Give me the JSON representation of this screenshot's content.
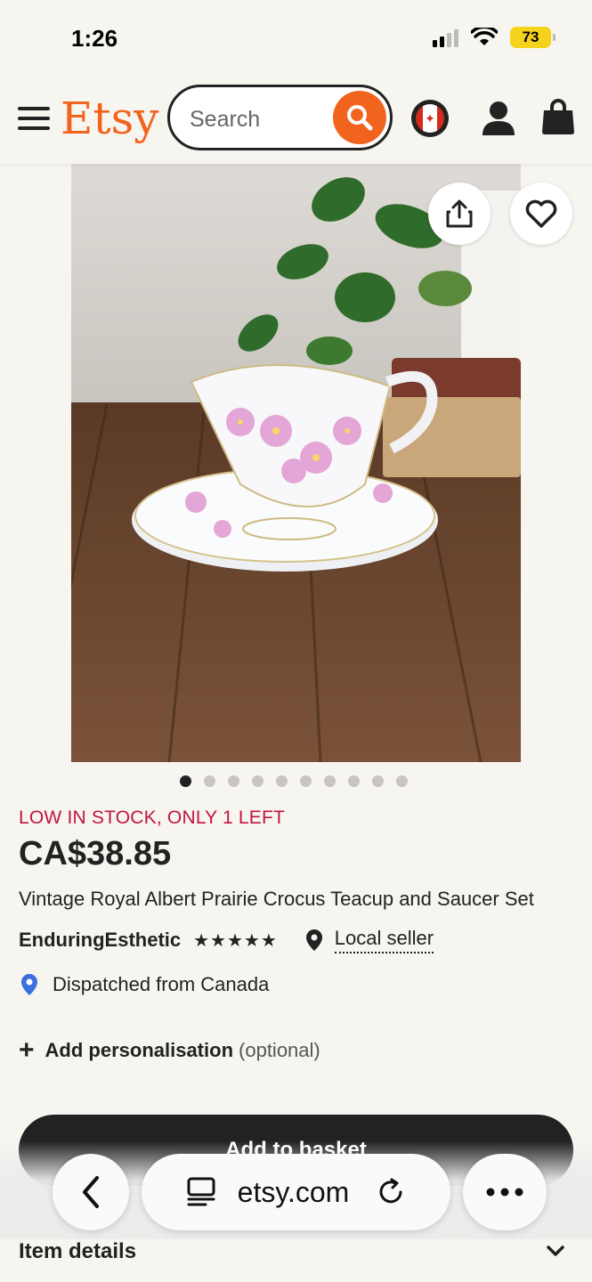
{
  "status_bar": {
    "time": "1:26",
    "battery": "73"
  },
  "header": {
    "logo": "Etsy",
    "search_placeholder": "Search",
    "icons": [
      "menu-icon",
      "search-icon",
      "canada-flag-icon",
      "user-icon",
      "basket-icon"
    ]
  },
  "gallery": {
    "image_count": 10,
    "active_index": 0,
    "share_icon": "share-icon",
    "favorite_icon": "heart-icon"
  },
  "product": {
    "stock_notice": "LOW IN STOCK, ONLY 1 LEFT",
    "price": "CA$38.85",
    "title": "Vintage Royal Albert Prairie Crocus Teacup and Saucer Set",
    "seller": "EnduringEsthetic",
    "rating_stars": "★★★★★",
    "local_seller": "Local seller",
    "dispatch": "Dispatched from Canada",
    "personalisation_label": "Add personalisation",
    "personalisation_optional": "(optional)",
    "add_to_basket": "Add to basket"
  },
  "browser": {
    "url": "etsy.com",
    "back_icon": "back-icon",
    "tabs_icon": "tabs-icon",
    "reload_icon": "reload-icon",
    "more_icon": "more-icon"
  },
  "item_details": {
    "label": "Item details"
  },
  "colors": {
    "brand": "#f1641e",
    "stock": "#c0163c",
    "dark": "#222222"
  }
}
